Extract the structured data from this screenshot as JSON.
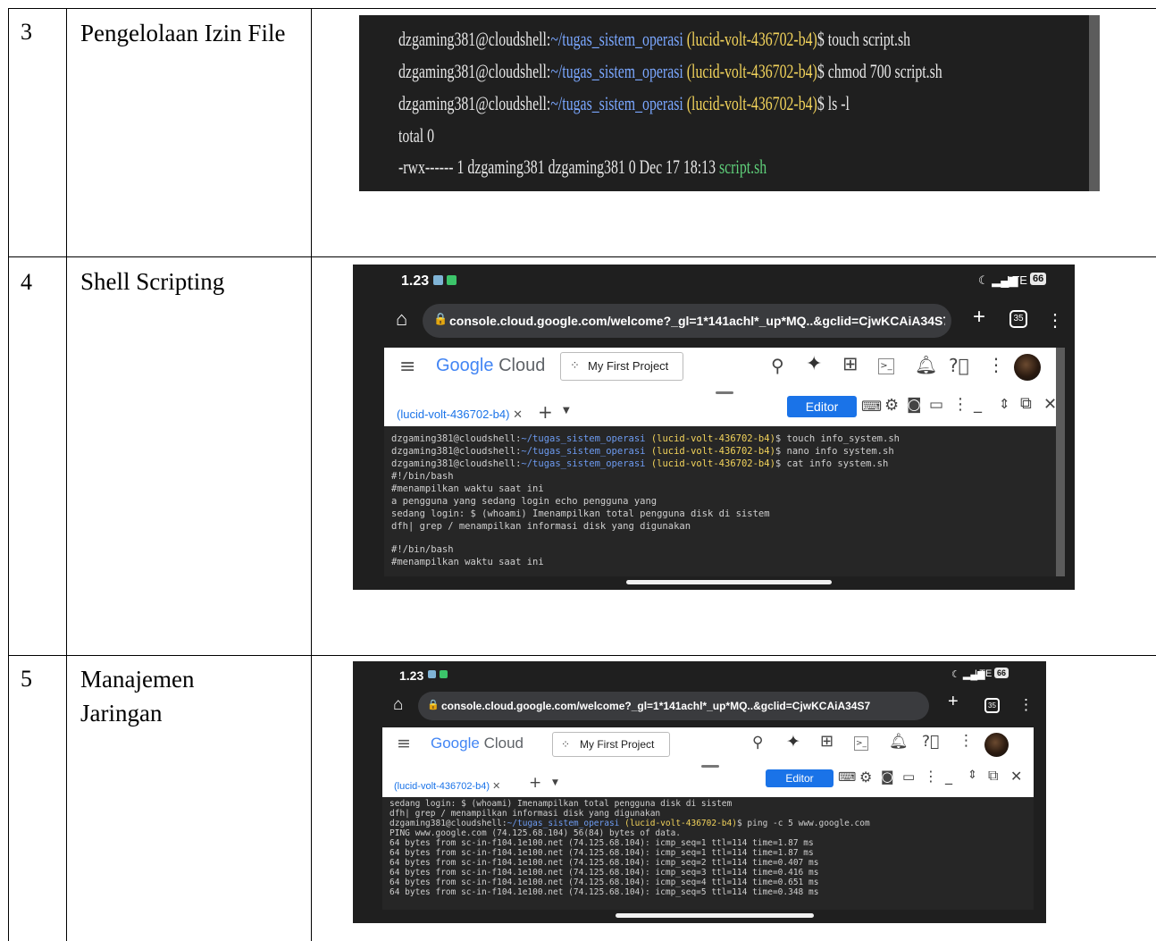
{
  "rows": [
    {
      "number": "3",
      "name": "Pengelolaan Izin File"
    },
    {
      "number": "4",
      "name": "Shell Scripting"
    },
    {
      "number": "5",
      "name_line1": "Manajemen",
      "name_line2": "Jaringan"
    }
  ],
  "row3_terminal": {
    "prompt_user": "dzgaming381@cloudshell:",
    "prompt_path": "~/tugas_sistem_operasi",
    "prompt_project": "(lucid-volt-436702-b4)",
    "cmd1": "$ touch script.sh",
    "cmd2": "$ chmod 700 script.sh",
    "cmd3": "$ ls -l",
    "total": "total 0",
    "ls_line": "-rwx------ 1 dzgaming381 dzgaming381 0 Dec 17 18:13 ",
    "ls_file": "script.sh"
  },
  "phone": {
    "time": "1.23",
    "signal": "LTE",
    "battery": "66",
    "url": "console.cloud.google.com/welcome?_gl=1*141achl*_up*MQ..&gclid=CjwKCAiA34S7",
    "tab_count": "35",
    "brand_google": "Google",
    "brand_cloud": "Cloud",
    "project": "My First Project",
    "tab_label": "(lucid-volt-436702-b4)",
    "editor": "Editor"
  },
  "row4_terminal": [
    "dzgaming381@cloudshell:~/tugas_sistem_operasi (lucid-volt-436702-b4)$ touch info_system.sh",
    "dzgaming381@cloudshell:~/tugas_sistem_operasi (lucid-volt-436702-b4)$ nano info system.sh",
    "dzgaming381@cloudshell:~/tugas_sistem_operasi (lucid-volt-436702-b4)$ cat info system.sh",
    "#!/bin/bash",
    "#menampilkan waktu saat ini",
    "a pengguna yang sedang login echo pengguna yang",
    "sedang login: $ (whoami) Imenampilkan total pengguna disk di sistem",
    "dfh| grep / menampilkan informasi disk yang digunakan",
    "",
    "#!/bin/bash",
    "#menampilkan waktu saat ini"
  ],
  "row5_terminal": [
    "sedang login: $ (whoami) Imenampilkan total pengguna disk di sistem",
    "dfh| grep / menampilkan informasi disk yang digunakan",
    "dzgaming381@cloudshell:~/tugas_sistem_operasi (lucid-volt-436702-b4)$ ping -c 5 www.google.com",
    "PING www.google.com (74.125.68.104) 56(84) bytes of data.",
    "64 bytes from sc-in-f104.1e100.net (74.125.68.104): icmp_seq=1 ttl=114 time=1.87 ms",
    "64 bytes from sc-in-f104.1e100.net (74.125.68.104): icmp_seq=1 ttl=114 time=1.87 ms",
    "64 bytes from sc-in-f104.1e100.net (74.125.68.104): icmp_seq=2 ttl=114 time=0.407 ms",
    "64 bytes from sc-in-f104.1e100.net (74.125.68.104): icmp_seq=3 ttl=114 time=0.416 ms",
    "64 bytes from sc-in-f104.1e100.net (74.125.68.104): icmp_seq=4 ttl=114 time=0.651 ms",
    "64 bytes from sc-in-f104.1e100.net (74.125.68.104): icmp_seq=5 ttl=114 time=0.348 ms"
  ]
}
